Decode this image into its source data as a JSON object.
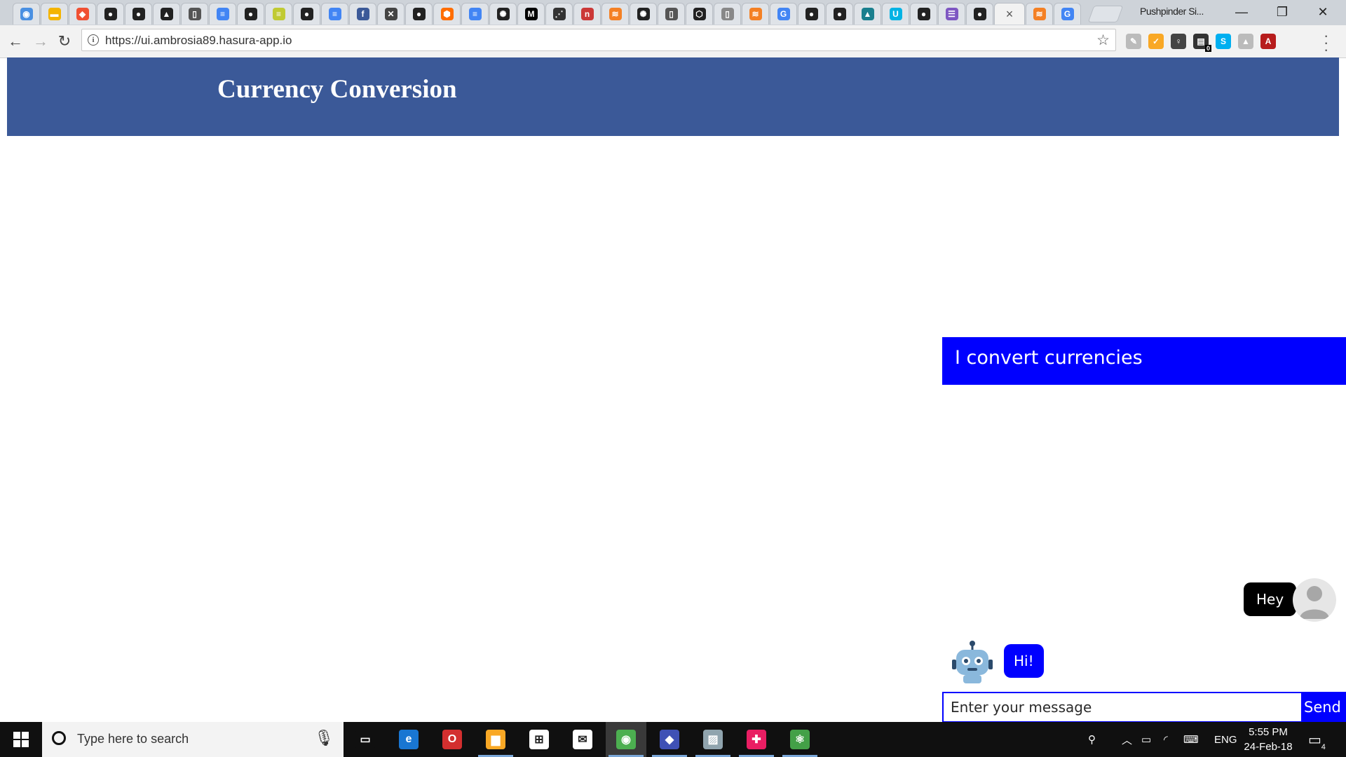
{
  "browser": {
    "tabs": [
      {
        "icon": "chrome-icon",
        "color": "#4a90e2",
        "glyph": "◉"
      },
      {
        "icon": "drive-icon",
        "color": "#f4b400",
        "glyph": "▬"
      },
      {
        "icon": "git-icon",
        "color": "#f05033",
        "glyph": "◆"
      },
      {
        "icon": "github-icon",
        "color": "#222222",
        "glyph": "●"
      },
      {
        "icon": "github-icon",
        "color": "#222222",
        "glyph": "●"
      },
      {
        "icon": "octocat-icon",
        "color": "#222222",
        "glyph": "▲"
      },
      {
        "icon": "codepen-file-icon",
        "color": "#555555",
        "glyph": "▯"
      },
      {
        "icon": "docs-icon",
        "color": "#4285f4",
        "glyph": "≡"
      },
      {
        "icon": "github-icon",
        "color": "#222222",
        "glyph": "●"
      },
      {
        "icon": "notes-icon",
        "color": "#c0ca33",
        "glyph": "≡"
      },
      {
        "icon": "github-icon",
        "color": "#222222",
        "glyph": "●"
      },
      {
        "icon": "docs-icon",
        "color": "#4285f4",
        "glyph": "≡"
      },
      {
        "icon": "facebook-icon",
        "color": "#3b5998",
        "glyph": "f"
      },
      {
        "icon": "tool-icon",
        "color": "#444444",
        "glyph": "✕"
      },
      {
        "icon": "github-icon",
        "color": "#222222",
        "glyph": "●"
      },
      {
        "icon": "polymer-icon",
        "color": "#ff6d00",
        "glyph": "⬢"
      },
      {
        "icon": "docs-icon",
        "color": "#4285f4",
        "glyph": "≡"
      },
      {
        "icon": "react-icon",
        "color": "#222222",
        "glyph": "✺"
      },
      {
        "icon": "medium-icon",
        "color": "#000000",
        "glyph": "M"
      },
      {
        "icon": "network-icon",
        "color": "#333333",
        "glyph": "⋰"
      },
      {
        "icon": "npm-icon",
        "color": "#cb3837",
        "glyph": "n"
      },
      {
        "icon": "stackoverflow-icon",
        "color": "#f48024",
        "glyph": "≋"
      },
      {
        "icon": "react-icon",
        "color": "#222222",
        "glyph": "✺"
      },
      {
        "icon": "codepen-file-icon",
        "color": "#555555",
        "glyph": "▯"
      },
      {
        "icon": "codepen-icon",
        "color": "#222222",
        "glyph": "⬡"
      },
      {
        "icon": "blank-page-icon",
        "color": "#888888",
        "glyph": "▯"
      },
      {
        "icon": "stackoverflow-icon",
        "color": "#f48024",
        "glyph": "≋"
      },
      {
        "icon": "google-icon",
        "color": "#4285f4",
        "glyph": "G"
      },
      {
        "icon": "github-icon",
        "color": "#222222",
        "glyph": "●"
      },
      {
        "icon": "github-icon",
        "color": "#222222",
        "glyph": "●"
      },
      {
        "icon": "graduation-icon",
        "color": "#1a7f8e",
        "glyph": "▲"
      },
      {
        "icon": "udacity-icon",
        "color": "#02b3e4",
        "glyph": "U"
      },
      {
        "icon": "github-icon",
        "color": "#222222",
        "glyph": "●"
      },
      {
        "icon": "list-icon",
        "color": "#7e57c2",
        "glyph": "☰"
      },
      {
        "icon": "github-icon",
        "color": "#222222",
        "glyph": "●"
      },
      {
        "icon": "close-icon",
        "color": "#555555",
        "glyph": "×",
        "active": true
      },
      {
        "icon": "stackoverflow-icon",
        "color": "#f48024",
        "glyph": "≋"
      },
      {
        "icon": "google-icon",
        "color": "#4285f4",
        "glyph": "G"
      }
    ],
    "profile_name": "Pushpinder Si...",
    "url": "https://ui.ambrosia89.hasura-app.io",
    "extensions": [
      {
        "icon": "paint-icon",
        "color": "#bbbbbb",
        "glyph": "✎"
      },
      {
        "icon": "norton-icon",
        "color": "#f9a825",
        "glyph": "✓"
      },
      {
        "icon": "lightbulb-icon",
        "color": "#444444",
        "glyph": "♀"
      },
      {
        "icon": "clipboard-icon",
        "color": "#333333",
        "glyph": "▤",
        "badge": "0"
      },
      {
        "icon": "skype-icon",
        "color": "#00aff0",
        "glyph": "S"
      },
      {
        "icon": "drive-icon",
        "color": "#bbbbbb",
        "glyph": "▲"
      },
      {
        "icon": "pdf-icon",
        "color": "#b71c1c",
        "glyph": "A"
      }
    ]
  },
  "page": {
    "title": "Currency Conversion",
    "chat": {
      "header": "I convert currencies",
      "user_message": "Hey",
      "bot_message": "Hi!",
      "input_placeholder": "Enter your message",
      "send_label": "Send",
      "colors": {
        "accent": "#0000ff",
        "header": "#3b5998"
      }
    }
  },
  "taskbar": {
    "search_placeholder": "Type here to search",
    "apps": [
      {
        "icon": "task-view-icon",
        "color": "#101010",
        "glyph": "▭"
      },
      {
        "icon": "edge-icon",
        "color": "#1976d2",
        "glyph": "e"
      },
      {
        "icon": "opera-icon",
        "color": "#d32f2f",
        "glyph": "O"
      },
      {
        "icon": "file-explorer-icon",
        "color": "#f9a825",
        "glyph": "▆"
      },
      {
        "icon": "store-icon",
        "color": "#ffffff",
        "glyph": "⊞"
      },
      {
        "icon": "mail-icon",
        "color": "#ffffff",
        "glyph": "✉"
      },
      {
        "icon": "chrome-icon",
        "color": "#4caf50",
        "glyph": "◉",
        "active": true
      },
      {
        "icon": "git-kraken-icon",
        "color": "#3f51b5",
        "glyph": "◆"
      },
      {
        "icon": "photos-icon",
        "color": "#90a4ae",
        "glyph": "▨"
      },
      {
        "icon": "slack-icon",
        "color": "#e91e63",
        "glyph": "✚"
      },
      {
        "icon": "atom-icon",
        "color": "#43a047",
        "glyph": "⚛"
      }
    ],
    "language": "ENG",
    "time": "5:55 PM",
    "date": "24-Feb-18",
    "notification_count": "4"
  }
}
